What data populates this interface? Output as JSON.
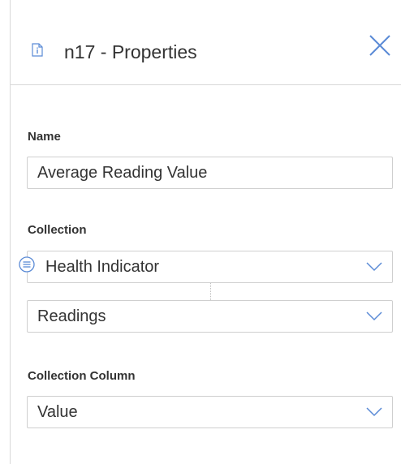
{
  "header": {
    "title": "n17 - Properties",
    "icon": "info-document-icon",
    "close_icon": "close-icon"
  },
  "name_field": {
    "label": "Name",
    "value": "Average Reading Value"
  },
  "collection": {
    "label": "Collection",
    "primary": {
      "value": "Health Indicator",
      "icon": "list-icon"
    },
    "secondary": {
      "value": "Readings"
    }
  },
  "collection_column": {
    "label": "Collection Column",
    "value": "Value"
  },
  "colors": {
    "accent": "#5b8bd6",
    "border": "#cfcfcf",
    "text": "#333333"
  }
}
